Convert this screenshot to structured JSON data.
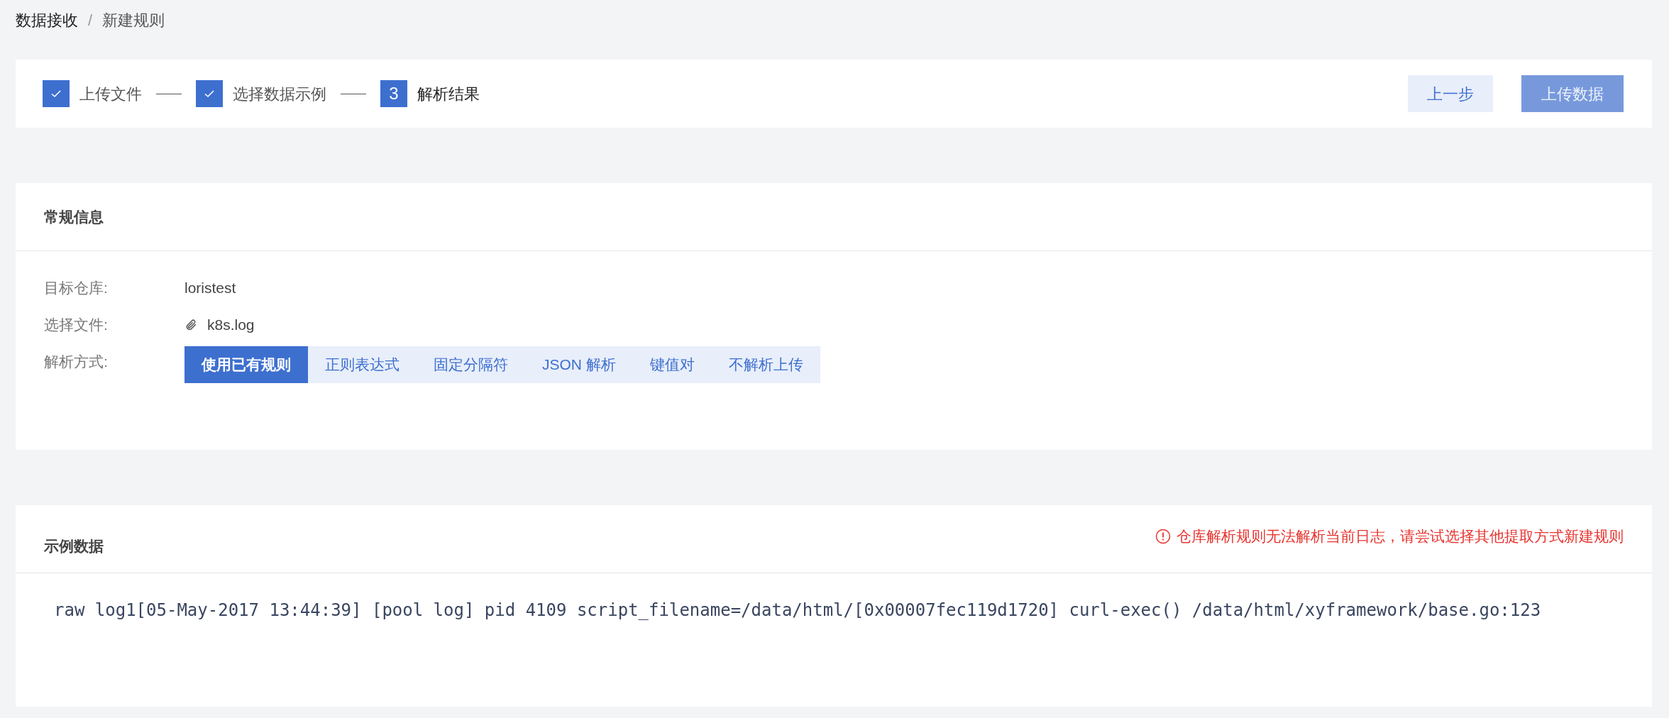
{
  "breadcrumb": [
    {
      "label": "数据接收",
      "current": false
    },
    {
      "label": "新建规则",
      "current": true
    }
  ],
  "breadcrumb_separator": "/",
  "steps": [
    {
      "done": true,
      "label": "上传文件"
    },
    {
      "done": true,
      "label": "选择数据示例"
    },
    {
      "done": false,
      "number": "3",
      "label": "解析结果"
    }
  ],
  "actions": [
    {
      "kind": "secondary",
      "label": "上一步"
    },
    {
      "kind": "primary",
      "label": "上传数据"
    }
  ],
  "general": {
    "title": "常规信息",
    "fields": [
      {
        "kind": "text",
        "label": "目标仓库:",
        "value": "loristest"
      },
      {
        "kind": "file",
        "label": "选择文件:",
        "value": "k8s.log"
      },
      {
        "kind": "segmented",
        "label": "解析方式:",
        "options": [
          {
            "label": "使用已有规则",
            "selected": true
          },
          {
            "label": "正则表达式",
            "selected": false
          },
          {
            "label": "固定分隔符",
            "selected": false
          },
          {
            "label": "JSON 解析",
            "selected": false
          },
          {
            "label": "键值对",
            "selected": false
          },
          {
            "label": "不解析上传",
            "selected": false
          }
        ]
      }
    ]
  },
  "sample": {
    "title": "示例数据",
    "error": "仓库解析规则无法解析当前日志，请尝试选择其他提取方式新建规则",
    "log": "raw log1[05-May-2017 13:44:39] [pool log] pid 4109 script_filename=/data/html/[0x00007fec119d1720] curl-exec() /data/html/xyframework/base.go:123"
  }
}
